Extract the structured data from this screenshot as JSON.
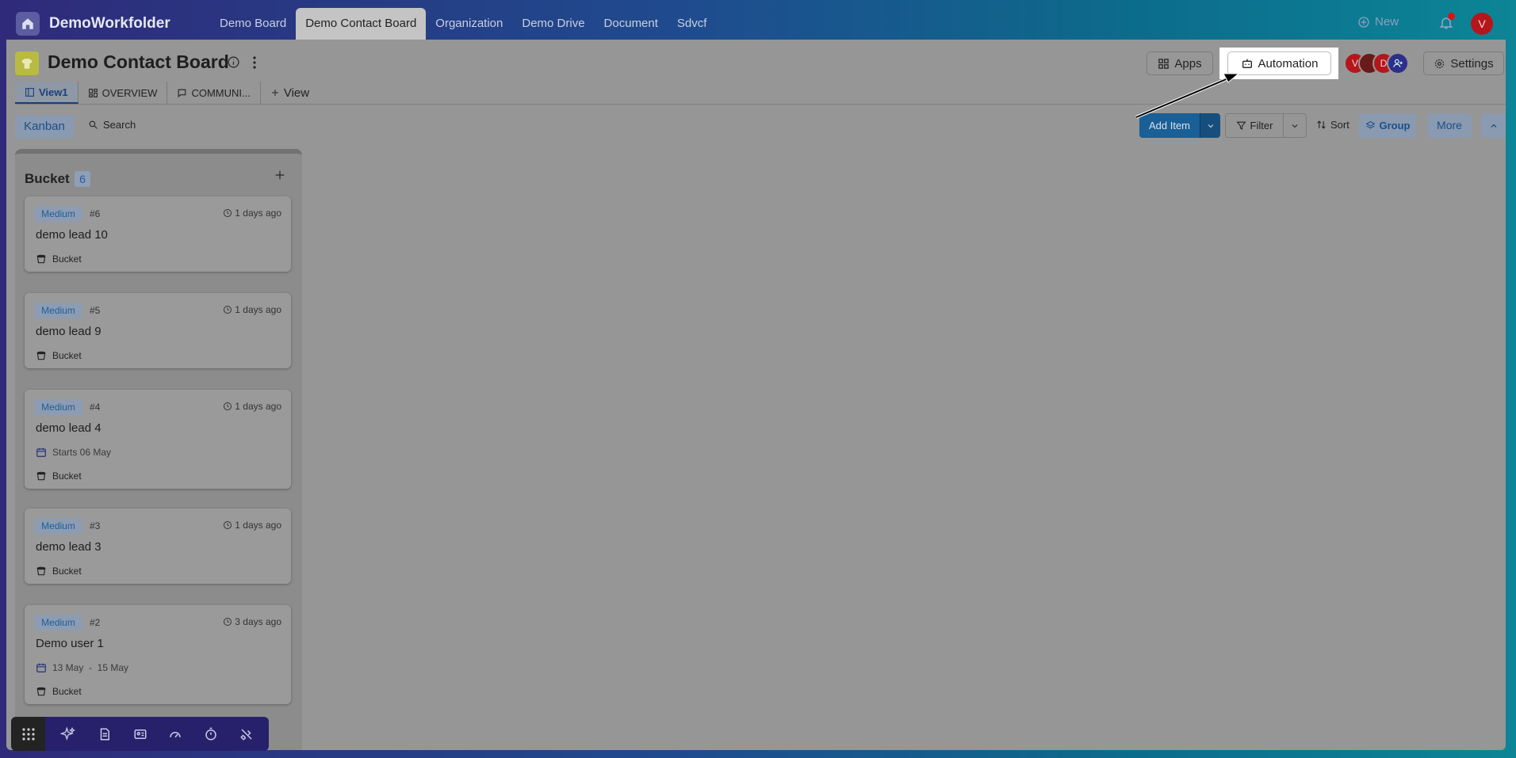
{
  "app": {
    "brand": "DemoWorkfolder"
  },
  "nav": {
    "tabs": [
      "Demo Board",
      "Demo Contact Board",
      "Organization",
      "Demo Drive",
      "Document",
      "Sdvcf"
    ],
    "active": "Demo Contact Board"
  },
  "topright": {
    "new_label": "New",
    "user_initial": "V"
  },
  "board": {
    "title": "Demo Contact Board"
  },
  "header_buttons": {
    "apps": "Apps",
    "automation": "Automation",
    "settings": "Settings"
  },
  "members": [
    "V",
    "",
    "D"
  ],
  "view_tabs": [
    "View1",
    "OVERVIEW",
    "COMMUNI..."
  ],
  "add_view": "View",
  "toolbar": {
    "kanban": "Kanban",
    "search": "Search",
    "add_item": "Add Item",
    "filter": "Filter",
    "sort": "Sort",
    "group": "Group",
    "more": "More"
  },
  "column": {
    "title": "Bucket",
    "count": "6"
  },
  "cards": [
    {
      "badge": "Medium",
      "num": "#6",
      "ago": "1 days ago",
      "title": "demo lead 10",
      "bucket": "Bucket"
    },
    {
      "badge": "Medium",
      "num": "#5",
      "ago": "1 days ago",
      "title": "demo lead 9",
      "bucket": "Bucket"
    },
    {
      "badge": "Medium",
      "num": "#4",
      "ago": "1 days ago",
      "title": "demo lead 4",
      "dates": "Starts 06 May",
      "bucket": "Bucket"
    },
    {
      "badge": "Medium",
      "num": "#3",
      "ago": "1 days ago",
      "title": "demo lead 3",
      "bucket": "Bucket"
    },
    {
      "badge": "Medium",
      "num": "#2",
      "ago": "3 days ago",
      "title": "Demo user 1",
      "dates": "13 May  -  15 May",
      "bucket": "Bucket"
    }
  ],
  "peek_text": "ago",
  "colors": {
    "brand_blue": "#1a5f95",
    "accent_text": "#1c4f89",
    "avatar_red": "#b5161b",
    "bottom_bar": "#27216b"
  }
}
